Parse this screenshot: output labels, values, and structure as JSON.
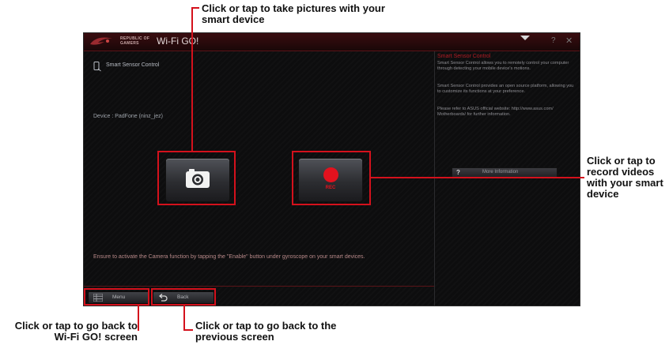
{
  "window": {
    "brand_line1": "REPUBLIC OF",
    "brand_line2": "GAMERS",
    "title": "Wi-Fi GO!"
  },
  "main": {
    "section_title": "Smart Sensor Control",
    "device": "Device : PadFone (ninz_jez)",
    "record_label": "REC",
    "hint": "Ensure to activate the Camera function by tapping the  \"Enable\" button under gyroscope on your smart devices."
  },
  "side": {
    "title": "Smart Sensor Control",
    "para1": "Smart Sensor Control allows you to remotely control your computer through detecting your mobile device's motions.",
    "para2": "Smart Sensor Control provides an open source platform, allowing you to customize its functions at your preference.",
    "para3": "Please refer to ASUS official website: http://www.asus.com/ Motherboards/ for further information.",
    "more_info_label": "More Information",
    "more_info_icon_text": "?"
  },
  "bottom": {
    "menu_label": "Menu",
    "back_label": "Back"
  },
  "callouts": {
    "take_pictures": "Click or tap to take pictures with your smart device",
    "record_videos": "Click or tap to record videos with your smart device",
    "back_to_wifi": "Click or tap to go back to Wi-Fi GO! screen",
    "back_previous": "Click or tap to go back to the previous screen"
  },
  "colors": {
    "accent_red": "#d4111c",
    "window_bg": "#0d0d0e"
  }
}
